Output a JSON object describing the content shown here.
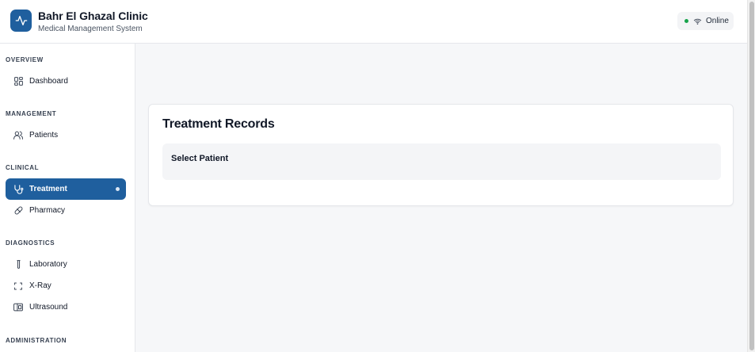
{
  "app": {
    "title": "Bahr El Ghazal Clinic",
    "subtitle": "Medical Management System",
    "logo_icon": "activity-pulse-icon",
    "brand_color": "#1f5f9e"
  },
  "status": {
    "label": "Online",
    "icon": "wifi-icon",
    "dot_color": "#16a34a"
  },
  "sidebar": {
    "sections": [
      {
        "title": "OVERVIEW"
      },
      {
        "title": "MANAGEMENT"
      },
      {
        "title": "CLINICAL"
      },
      {
        "title": "DIAGNOSTICS"
      },
      {
        "title": "ADMINISTRATION"
      }
    ],
    "items": [
      {
        "label": "Dashboard",
        "icon": "grid-icon"
      },
      {
        "label": "Patients",
        "icon": "users-icon"
      },
      {
        "label": "Treatment",
        "icon": "stethoscope-icon",
        "active": true
      },
      {
        "label": "Pharmacy",
        "icon": "pill-icon"
      },
      {
        "label": "Laboratory",
        "icon": "test-tube-icon"
      },
      {
        "label": "X-Ray",
        "icon": "scan-icon"
      },
      {
        "label": "Ultrasound",
        "icon": "ultrasound-icon"
      }
    ]
  },
  "main": {
    "card_title": "Treatment Records",
    "select_label": "Select Patient"
  }
}
